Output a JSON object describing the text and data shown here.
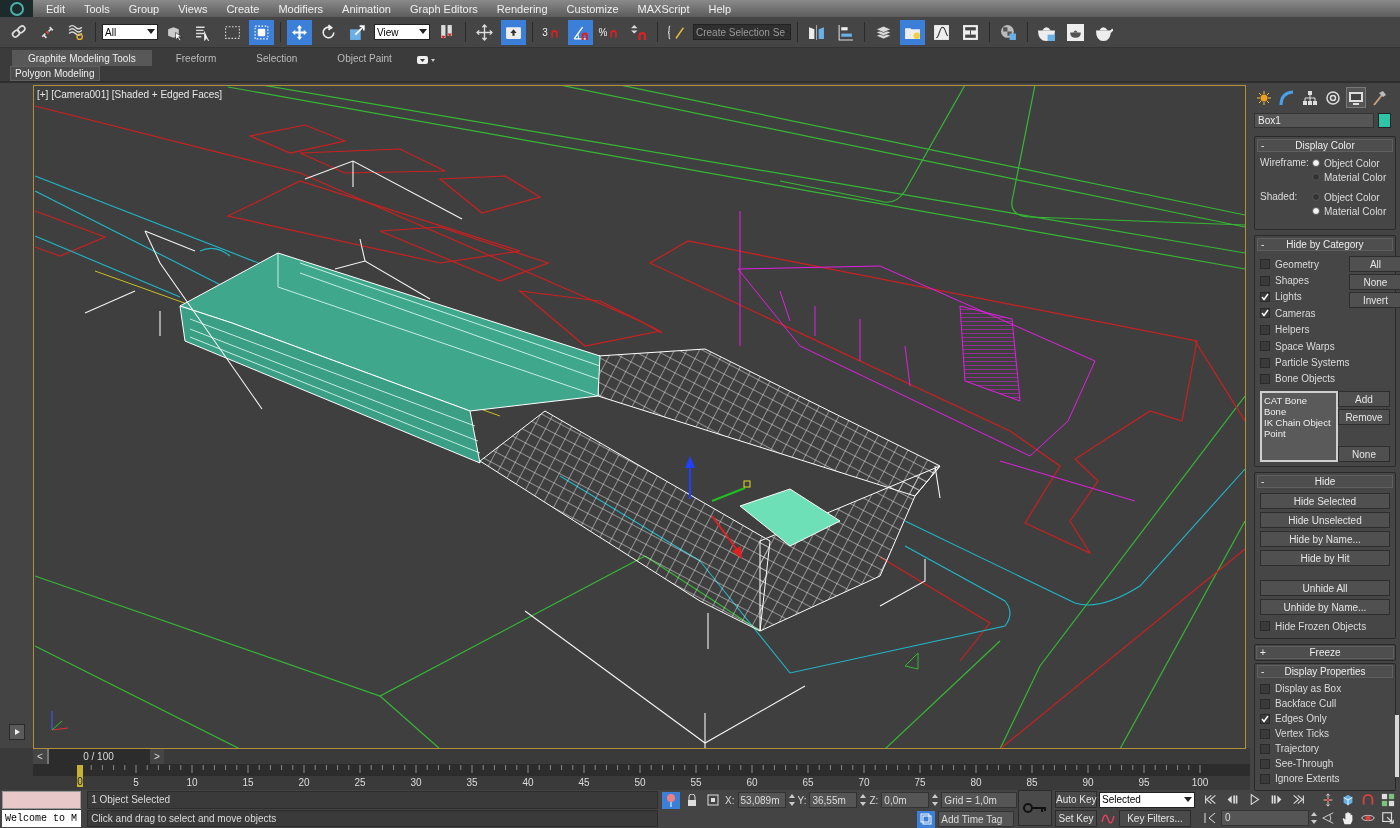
{
  "menu": [
    "Edit",
    "Tools",
    "Group",
    "Views",
    "Create",
    "Modifiers",
    "Animation",
    "Graph Editors",
    "Rendering",
    "Customize",
    "MAXScript",
    "Help"
  ],
  "toolbar": [
    [
      {
        "kind": "link",
        "active": false
      },
      {
        "kind": "unlink",
        "active": false
      },
      {
        "kind": "bind",
        "active": false
      }
    ],
    [
      {
        "kind": "dropdown",
        "value": "All"
      },
      {
        "kind": "select",
        "active": false
      },
      {
        "kind": "select_by_name",
        "active": false
      },
      {
        "kind": "region",
        "active": false
      },
      {
        "kind": "crossing",
        "active": true
      }
    ],
    [
      {
        "kind": "move",
        "active": true
      },
      {
        "kind": "rotate",
        "active": false
      },
      {
        "kind": "scale",
        "active": false
      },
      {
        "kind": "dropdown",
        "value": "View"
      },
      {
        "kind": "pivot",
        "active": false
      }
    ],
    [
      {
        "kind": "manipulate",
        "active": false
      },
      {
        "kind": "shortcut",
        "active": true
      }
    ],
    [
      {
        "kind": "snap",
        "label": "3",
        "active": false
      },
      {
        "kind": "angle_snap",
        "active": true
      },
      {
        "kind": "percent_snap",
        "label": "%",
        "active": false
      },
      {
        "kind": "spinner_snap",
        "active": false
      }
    ],
    [
      {
        "kind": "named_sel",
        "active": false
      },
      {
        "kind": "field",
        "placeholder": "Create Selection Se"
      }
    ],
    [
      {
        "kind": "mirror",
        "active": false
      },
      {
        "kind": "align",
        "active": false
      }
    ],
    [
      {
        "kind": "layers",
        "active": false
      },
      {
        "kind": "explorer",
        "active": true
      },
      {
        "kind": "curve",
        "active": false
      },
      {
        "kind": "schematic",
        "active": false
      }
    ],
    [
      {
        "kind": "material",
        "active": false
      }
    ],
    [
      {
        "kind": "render_setup",
        "active": false
      },
      {
        "kind": "render_frame",
        "active": false
      },
      {
        "kind": "render",
        "active": false
      }
    ]
  ],
  "ribbon_tabs": [
    {
      "label": "Graphite Modeling Tools",
      "selected": true
    },
    {
      "label": "Freeform",
      "selected": false
    },
    {
      "label": "Selection",
      "selected": false
    },
    {
      "label": "Object Paint",
      "selected": false
    }
  ],
  "ribbon_panel": "Polygon Modeling",
  "viewport": {
    "label": "[+] [Camera001] [Shaded + Edged Faces]",
    "active": true
  },
  "command_tabs": [
    {
      "kind": "create",
      "selected": false
    },
    {
      "kind": "modify",
      "selected": false
    },
    {
      "kind": "hierarchy",
      "selected": false
    },
    {
      "kind": "motion",
      "selected": false
    },
    {
      "kind": "display",
      "selected": true
    },
    {
      "kind": "utilities",
      "selected": false
    }
  ],
  "object": {
    "name": "Box1",
    "color": "#2ec4a8"
  },
  "display_color": {
    "sign": "-",
    "title": "Display Color",
    "groups": [
      {
        "label": "Wireframe:",
        "options": [
          {
            "label": "Object Color",
            "selected": true
          },
          {
            "label": "Material Color",
            "selected": false
          }
        ]
      },
      {
        "label": "Shaded:",
        "options": [
          {
            "label": "Object Color",
            "selected": false
          },
          {
            "label": "Material Color",
            "selected": true
          }
        ]
      }
    ]
  },
  "hide_by_category": {
    "sign": "-",
    "title": "Hide by Category",
    "checks": [
      {
        "label": "Geometry",
        "checked": false
      },
      {
        "label": "Shapes",
        "checked": false
      },
      {
        "label": "Lights",
        "checked": true
      },
      {
        "label": "Cameras",
        "checked": true
      },
      {
        "label": "Helpers",
        "checked": false
      },
      {
        "label": "Space Warps",
        "checked": false
      },
      {
        "label": "Particle Systems",
        "checked": false
      },
      {
        "label": "Bone Objects",
        "checked": false
      }
    ],
    "buttons": [
      "All",
      "None",
      "Invert"
    ],
    "list": [
      "CAT Bone",
      "Bone",
      "IK Chain Object",
      "Point"
    ],
    "list_buttons": [
      "Add",
      "Remove"
    ],
    "list_clear": "None"
  },
  "hide": {
    "sign": "-",
    "title": "Hide",
    "buttons": [
      "Hide Selected",
      "Hide Unselected",
      "Hide by Name...",
      "Hide by Hit"
    ],
    "unhide_buttons": [
      "Unhide All",
      "Unhide by Name..."
    ],
    "check": {
      "label": "Hide Frozen Objects",
      "checked": false
    }
  },
  "freeze": {
    "sign": "+",
    "title": "Freeze"
  },
  "display_properties": {
    "sign": "-",
    "title": "Display Properties",
    "checks": [
      {
        "label": "Display as Box",
        "checked": false
      },
      {
        "label": "Backface Cull",
        "checked": false
      },
      {
        "label": "Edges Only",
        "checked": true
      },
      {
        "label": "Vertex Ticks",
        "checked": false
      },
      {
        "label": "Trajectory",
        "checked": false
      },
      {
        "label": "See-Through",
        "checked": false
      },
      {
        "label": "Ignore Extents",
        "checked": false
      }
    ]
  },
  "time_slider": {
    "prev": "<",
    "position": "0 / 100",
    "next": ">",
    "level": 0
  },
  "trackbar": {
    "current": "0",
    "labels": [
      "5",
      "10",
      "15",
      "20",
      "25",
      "30",
      "35",
      "40",
      "45",
      "50",
      "55",
      "60",
      "65",
      "70",
      "75",
      "80",
      "85",
      "90",
      "95",
      "100"
    ]
  },
  "listener": {
    "output": "Welcome to M"
  },
  "status": {
    "selection": "1 Object Selected",
    "prompt": "Click and drag to select and move objects"
  },
  "coords": [
    {
      "axis": "X:",
      "value": "53,089m"
    },
    {
      "axis": "Y:",
      "value": "36,55m"
    },
    {
      "axis": "Z:",
      "value": "0,0m"
    }
  ],
  "grid": "Grid = 1,0m",
  "time_tag": "Add Time Tag",
  "auto_key": {
    "label": "Auto Key",
    "on": false
  },
  "set_key": "Set Key",
  "key_set": "Selected",
  "key_filters": "Key Filters...",
  "playback": [
    {
      "kind": "go_start"
    },
    {
      "kind": "prev_frame"
    },
    {
      "kind": "play"
    },
    {
      "kind": "next_frame"
    },
    {
      "kind": "go_end"
    }
  ],
  "frame": "0",
  "navigation": [
    {
      "kind": "zoom"
    },
    {
      "kind": "zoom_all"
    },
    {
      "kind": "orbit_sel"
    },
    {
      "kind": "max_toggle"
    },
    {
      "kind": "fov"
    },
    {
      "kind": "pan"
    },
    {
      "kind": "orbit"
    },
    {
      "kind": "maximize"
    }
  ]
}
